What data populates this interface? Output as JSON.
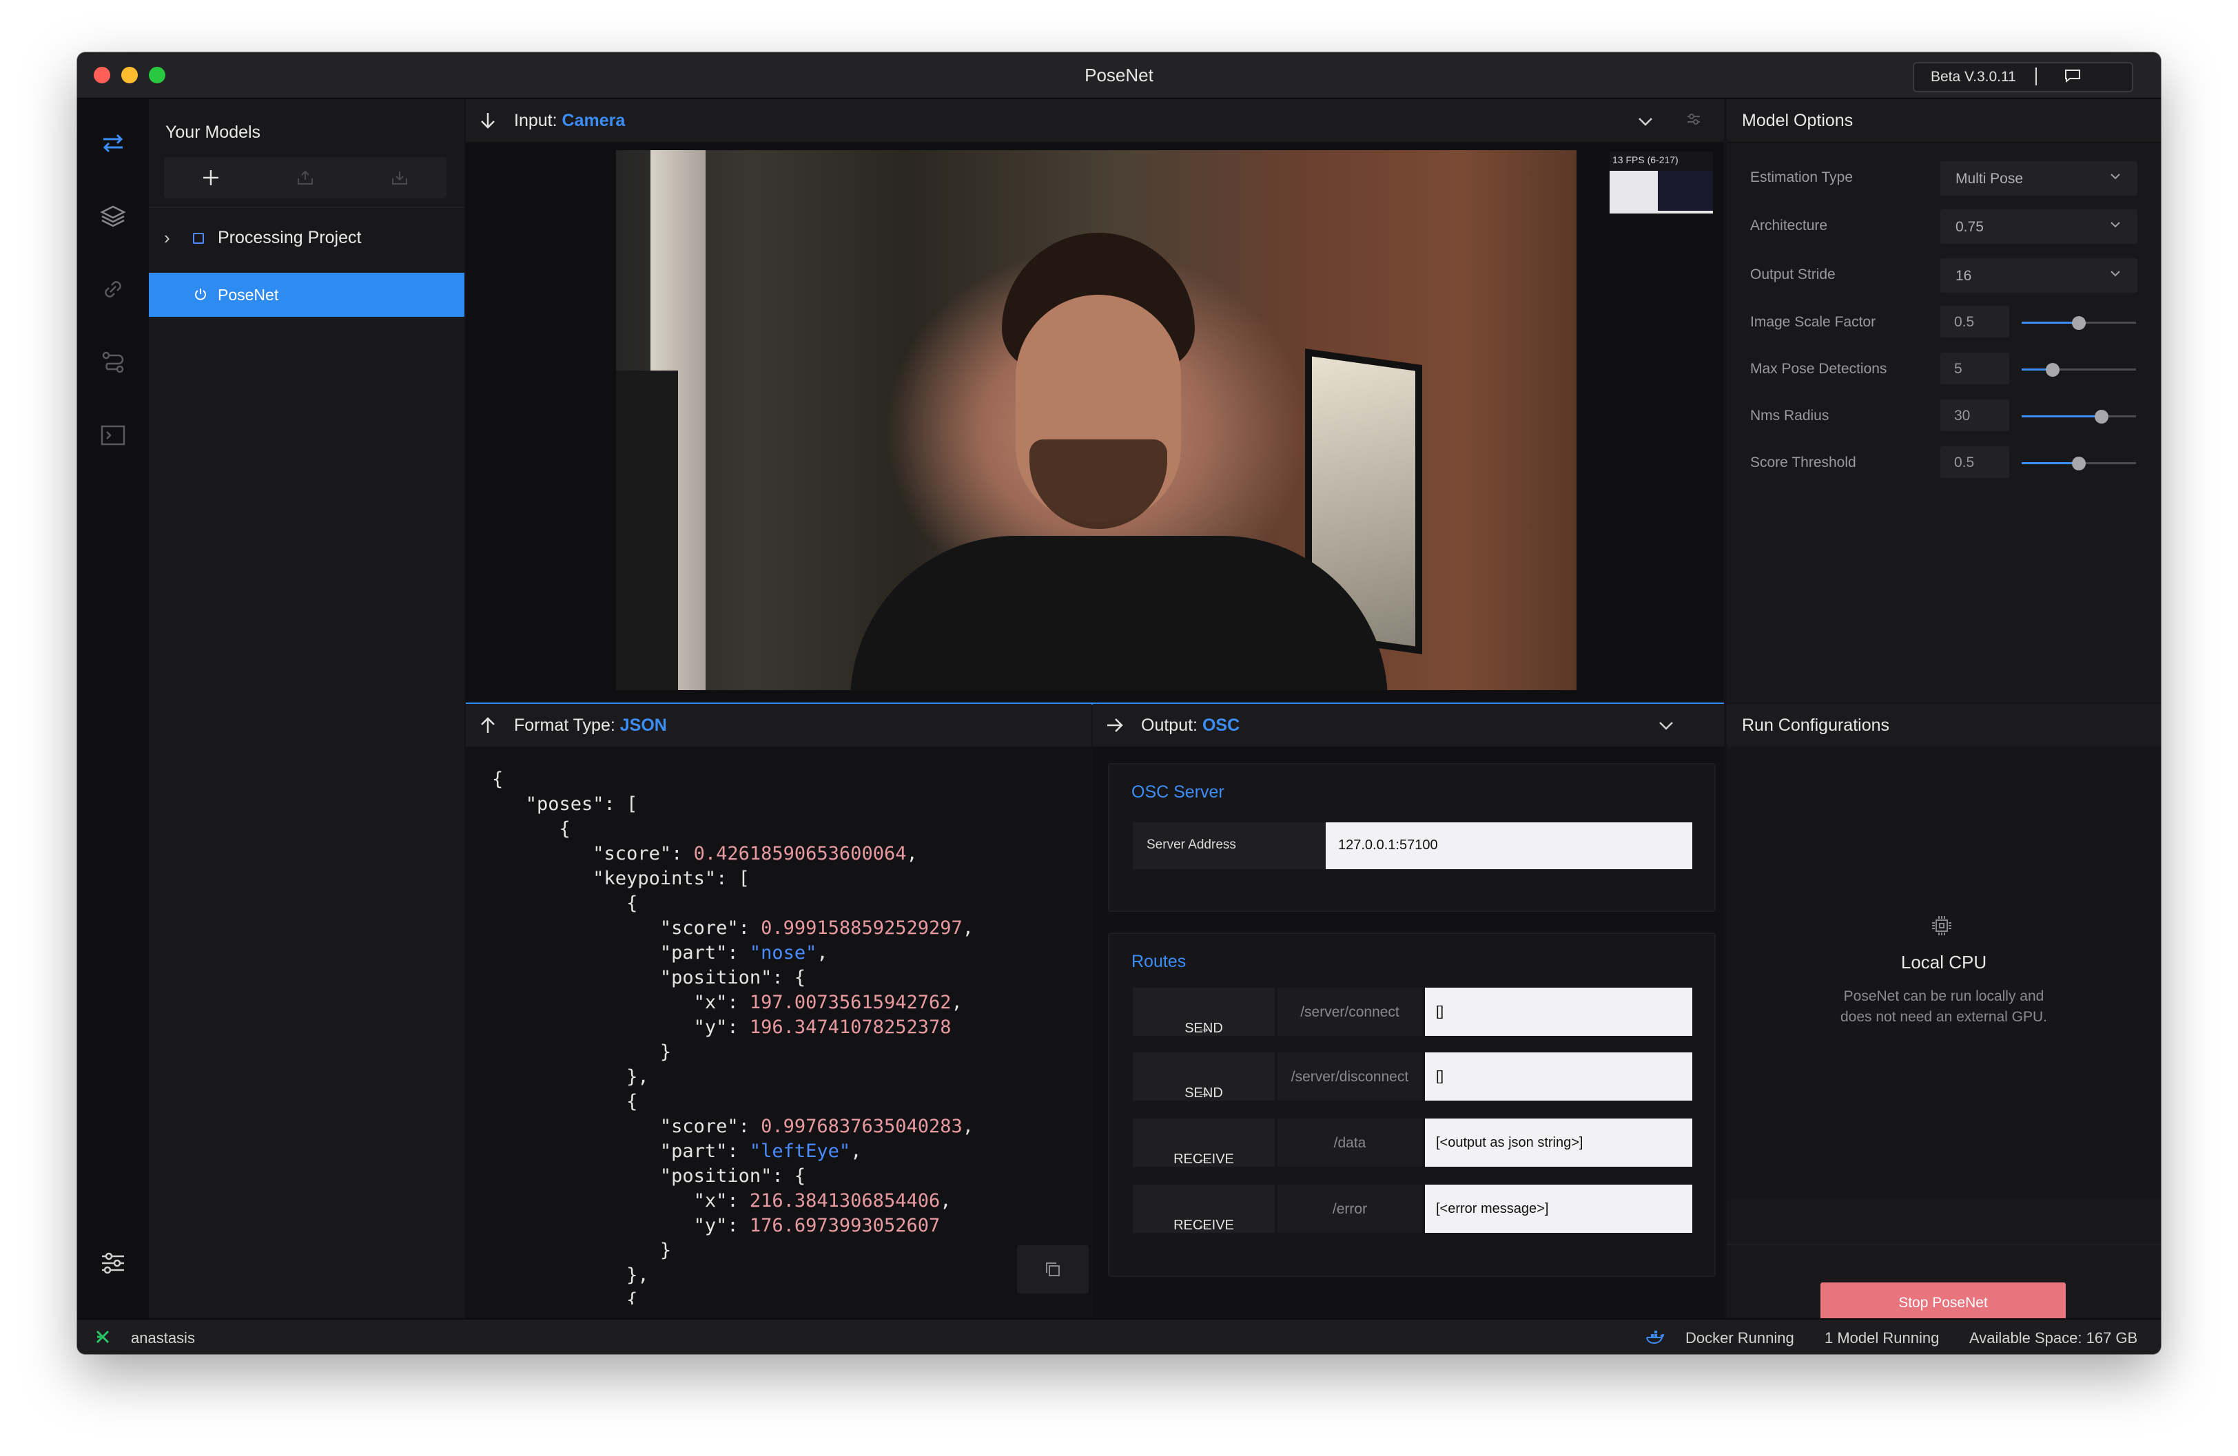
{
  "window": {
    "title": "PoseNet",
    "version": "Beta V.3.0.11"
  },
  "sidebar": {
    "title": "Your Models",
    "project": "Processing Project",
    "model": "PoseNet"
  },
  "input": {
    "label": "Input:",
    "source": "Camera",
    "fps_text": "13 FPS (6-217)"
  },
  "model_options": {
    "title": "Model Options",
    "estimation_type": {
      "label": "Estimation Type",
      "value": "Multi Pose"
    },
    "architecture": {
      "label": "Architecture",
      "value": "0.75"
    },
    "output_stride": {
      "label": "Output Stride",
      "value": "16"
    },
    "image_scale_factor": {
      "label": "Image Scale Factor",
      "value": "0.5",
      "level": 0.5
    },
    "max_pose_detections": {
      "label": "Max Pose Detections",
      "value": "5",
      "level": 0.27
    },
    "nms_radius": {
      "label": "Nms Radius",
      "value": "30",
      "level": 0.7
    },
    "score_threshold": {
      "label": "Score Threshold",
      "value": "0.5",
      "level": 0.5
    }
  },
  "format": {
    "label": "Format Type:",
    "type": "JSON",
    "code_lines": [
      "{",
      "   \"poses\": [",
      "      {",
      "         \"score\": 0.42618590653600064,",
      "         \"keypoints\": [",
      "            {",
      "               \"score\": 0.9991588592529297,",
      "               \"part\": \"nose\",",
      "               \"position\": {",
      "                  \"x\": 197.00735615942762,",
      "                  \"y\": 196.34741078252378",
      "               }",
      "            },",
      "            {",
      "               \"score\": 0.9976837635040283,",
      "               \"part\": \"leftEye\",",
      "               \"position\": {",
      "                  \"x\": 216.3841306854406,",
      "                  \"y\": 176.6973993052607",
      "               }",
      "            },",
      "            {"
    ]
  },
  "output": {
    "label": "Output:",
    "type": "OSC",
    "osc_server": {
      "title": "OSC Server",
      "address_label": "Server Address",
      "address_value": "127.0.0.1:57100"
    },
    "routes": {
      "title": "Routes",
      "items": [
        {
          "direction": "SEND",
          "arrow": "→",
          "path": "/server/connect",
          "message": "[]"
        },
        {
          "direction": "SEND",
          "arrow": "→",
          "path": "/server/disconnect",
          "message": "[]"
        },
        {
          "direction": "RECEIVE",
          "arrow": "←",
          "path": "/data",
          "message": "[<output as json string>]"
        },
        {
          "direction": "RECEIVE",
          "arrow": "←",
          "path": "/error",
          "message": "[<error message>]"
        }
      ]
    }
  },
  "run": {
    "title": "Run Configurations",
    "cpu_title": "Local CPU",
    "cpu_desc_1": "PoseNet can be run locally and",
    "cpu_desc_2": "does not need an external GPU.",
    "stop_label": "Stop PoseNet"
  },
  "status": {
    "user": "anastasis",
    "docker": "Docker Running",
    "models": "1 Model Running",
    "space": "Available Space: 167 GB"
  },
  "colors": {
    "accent": "#3d8df7",
    "selection": "#2e8bf0",
    "stop": "#e8747e"
  }
}
